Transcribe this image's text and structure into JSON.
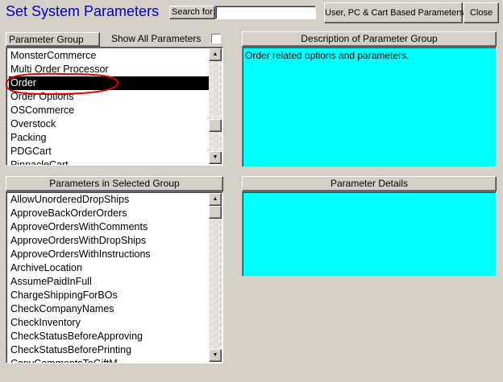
{
  "window": {
    "title": "Set System Parameters"
  },
  "toolbar": {
    "search_label": "Search for:",
    "search_value": "",
    "user_button": "User, PC & Cart Based Parameters",
    "close_button": "Close"
  },
  "group_panel": {
    "header": "Parameter Group",
    "show_all_label": "Show All Parameters",
    "show_all_checked": false,
    "selected_index": 2,
    "items": [
      "MonsterCommerce",
      "Multi Order Processor",
      "Order",
      "Order Options",
      "OSCommerce",
      "Overstock",
      "Packing",
      "PDGCart",
      "PinnacleCart"
    ]
  },
  "description_panel": {
    "header": "Description of Parameter Group",
    "text": "Order related options and parameters."
  },
  "params_panel": {
    "header": "Parameters in Selected Group",
    "items": [
      "AllowUnorderedDropShips",
      "ApproveBackOrderOrders",
      "ApproveOrdersWithComments",
      "ApproveOrdersWithDropShips",
      "ApproveOrdersWithInstructions",
      "ArchiveLocation",
      "AssumePaidInFull",
      "ChargeShippingForBOs",
      "CheckCompanyNames",
      "CheckInventory",
      "CheckStatusBeforeApproving",
      "CheckStatusBeforePrinting",
      "CopyCommentsToGiftM"
    ]
  },
  "details_panel": {
    "header": "Parameter Details",
    "text": ""
  },
  "colors": {
    "window_bg": "#d4d0c8",
    "title_blue": "#0000c0",
    "info_cyan": "#00ffff",
    "annotation_red": "#e00000"
  },
  "icons": {
    "scroll_up": "scroll-up-arrow-icon",
    "scroll_down": "scroll-down-arrow-icon"
  }
}
